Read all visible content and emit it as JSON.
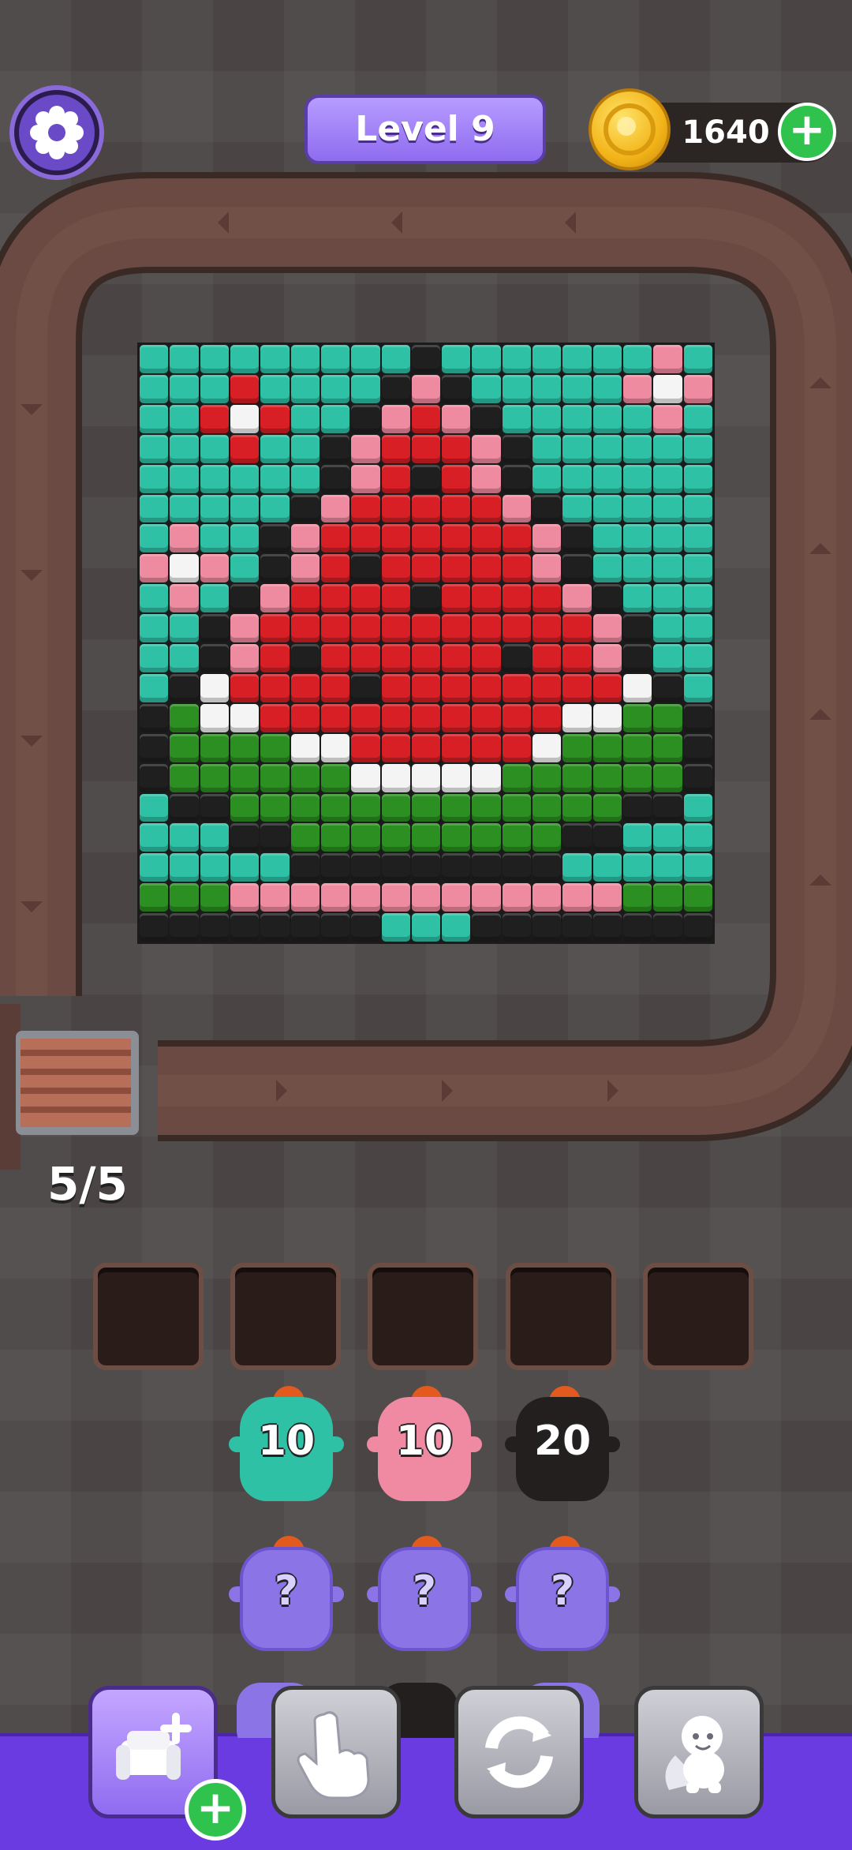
{
  "header": {
    "level_label": "Level 9",
    "coins": "1640"
  },
  "icons": {
    "settings": "gear-icon",
    "coin": "coin-icon",
    "add_coins": "plus-icon"
  },
  "conveyor": {
    "counter": "5/5"
  },
  "colors": {
    "T": "#2fc1a6",
    "K": "#1f1f1f",
    "R": "#d71f25",
    "P": "#ef8ba1",
    "W": "#f4f4f4",
    "G": "#2c8f22",
    "track": "#6b4a43",
    "accent": "#8f6cf0"
  },
  "board": {
    "rows": [
      "TTTTTTTTTKTTTTTTTPT",
      "TTTRTTTTKPKTTTTTPWP",
      "TTRWRTTKPRPKTTTTTPT",
      "TTTRTTKPRRRPKTTTTTT",
      "TTTTTTKPRKRPKTTTTTT",
      "TTTTTKPRRRRRPKTTTTT",
      "TPTTKPRRRRRRRPKTTTT",
      "PWPTKPRKRRRRRPKTTTT",
      "TPTKPRRRRKRRRRPKTTT",
      "TTKPRRRRRRRRRRRPKTT",
      "TTKPRKRRRRRRKRRPKTT",
      "TKWRRRRKRRRRRRRRWKT",
      "KGWWRRRRRRRRRRWWGGK",
      "KGGGGWWRRRRRRWGGGGK",
      "KGGGGGGWWWWWGGGGGGK",
      "TKKGGGGGGGGGGGGGKKT",
      "TTTKKGGGGGGGGGKKTTT",
      "TTTTTKKKKKKKKKTTTTT",
      "GGGPPPPPPPPPPPPPGGG",
      "KKKKKKKKTTTKKKKKKKK"
    ]
  },
  "queue": [
    {
      "color": "#2fc1a6",
      "count": "10",
      "name": "teal"
    },
    {
      "color": "#f08aa3",
      "count": "10",
      "name": "pink"
    },
    {
      "color": "#231f1f",
      "count": "20",
      "name": "black"
    },
    {
      "color": "#8a74e6",
      "count": "?",
      "name": "mystery"
    },
    {
      "color": "#8a74e6",
      "count": "?",
      "name": "mystery"
    },
    {
      "color": "#8a74e6",
      "count": "?",
      "name": "mystery"
    }
  ],
  "boosters": {
    "add_slot": "add-sofa-icon",
    "tap": "pointer-hand-icon",
    "shuffle": "shuffle-icon",
    "hero": "hero-character-icon"
  }
}
